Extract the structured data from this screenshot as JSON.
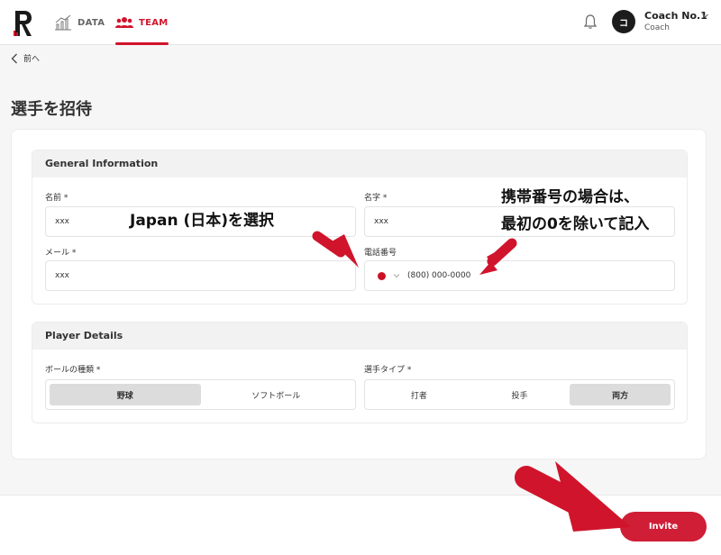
{
  "nav": {
    "items": [
      {
        "label": "DATA",
        "icon": "chart-bars-icon"
      },
      {
        "label": "TEAM",
        "icon": "team-people-icon"
      }
    ],
    "active": "TEAM",
    "user": {
      "initial": "コ",
      "name": "Coach No.1",
      "role": "Coach"
    }
  },
  "back_label": "前へ",
  "page_title": "選手を招待",
  "general": {
    "title": "General Information",
    "last_name": {
      "label": "名前 *",
      "value": "xxx"
    },
    "first_name": {
      "label": "名字 *",
      "value": "xxx"
    },
    "email": {
      "label": "メール *",
      "value": "xxx"
    },
    "phone": {
      "label": "電話番号",
      "value": "(800) 000-0000",
      "country": "Japan"
    }
  },
  "player": {
    "title": "Player Details",
    "ball_type": {
      "label": "ボールの種類 *",
      "options": [
        "野球",
        "ソフトボール"
      ],
      "selected": "野球"
    },
    "player_type": {
      "label": "選手タイプ *",
      "options": [
        "打者",
        "投手",
        "両方"
      ],
      "selected": "両方"
    }
  },
  "invite_label": "Invite",
  "annotations": {
    "country_note": "Japan (日本)を選択",
    "phone_note_line1": "携帯番号の場合は、",
    "phone_note_line2": "最初の0を除いて記入"
  },
  "colors": {
    "accent": "#cf1e36",
    "annotation_arrow": "#d0142c"
  }
}
